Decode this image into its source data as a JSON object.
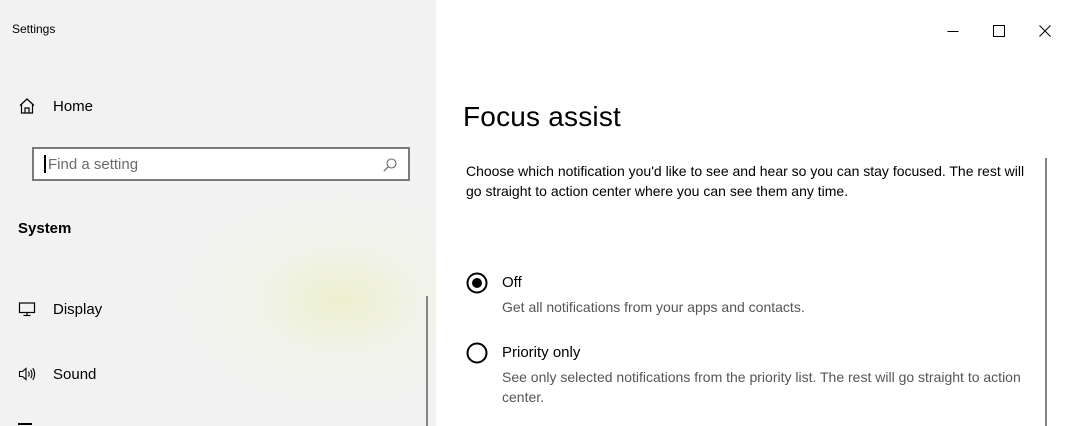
{
  "window": {
    "title": "Settings",
    "controls": {
      "minimize": "minimize-icon",
      "maximize": "maximize-icon",
      "close": "close-icon"
    }
  },
  "sidebar": {
    "home": {
      "label": "Home",
      "icon": "home-icon"
    },
    "search": {
      "placeholder": "Find a setting",
      "value": "",
      "icon": "search-icon"
    },
    "section_title": "System",
    "items": [
      {
        "label": "Display",
        "icon": "display-icon"
      },
      {
        "label": "Sound",
        "icon": "sound-icon"
      }
    ]
  },
  "main": {
    "title": "Focus assist",
    "description": "Choose which notification you'd like to see and hear so you can stay focused. The rest will go straight to action center where you can see them any time.",
    "options": [
      {
        "label": "Off",
        "description": "Get all notifications from your apps and contacts.",
        "selected": true
      },
      {
        "label": "Priority only",
        "description": "See only selected notifications from the priority list. The rest will go straight to action center.",
        "selected": false
      }
    ]
  },
  "colors": {
    "sidebar_bg": "#f2f2f2",
    "main_bg": "#ffffff",
    "text": "#000000",
    "secondary_text": "#555555",
    "input_border": "#7a7a7a"
  }
}
